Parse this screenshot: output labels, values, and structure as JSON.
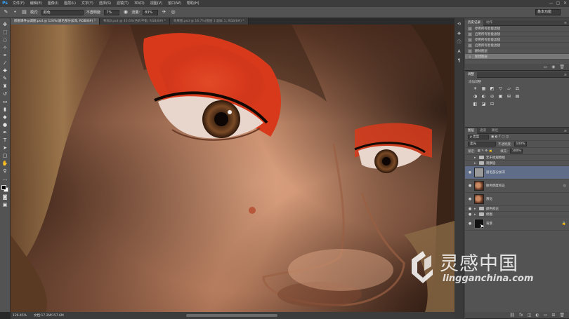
{
  "app": {
    "logo": "Ps",
    "menu": [
      "文件(F)",
      "编辑(E)",
      "图像(I)",
      "图层(L)",
      "文字(Y)",
      "选择(S)",
      "滤镜(T)",
      "3D(D)",
      "视图(V)",
      "窗口(W)",
      "帮助(H)"
    ],
    "window_controls": [
      "—",
      "▢",
      "✕"
    ]
  },
  "options": {
    "mode_label": "模式:",
    "mode_value": "颜色",
    "opacity_label": "不透明度:",
    "opacity_value": "7%",
    "flow_label": "流量:",
    "flow_value": "83%",
    "workspace": "基本功能"
  },
  "doc_tabs": [
    {
      "label": "修图课件@调图.psd @ 126%(眉毛部分加深, RGB/8#) *",
      "active": true
    },
    {
      "label": "布局3.psd @ 43.6%(色彩平衡, RGB/8#) *",
      "active": false
    },
    {
      "label": "效果图.psd @ 16.7%(图层 1 副本 1, RGB/8#) *",
      "active": false
    }
  ],
  "status": {
    "zoom": "126.45%",
    "doc_size": "文档:17.2M/157.6M"
  },
  "history": {
    "tabs": [
      "历史记录",
      "动作"
    ],
    "items": [
      "停用所有智能滤镜",
      "启用所有智能滤镜",
      "停用所有智能滤镜",
      "启用所有智能滤镜",
      "删除图层",
      "新建图层"
    ]
  },
  "adjustments": {
    "tab": "调整",
    "title": "添加调整",
    "icons": [
      "☀",
      "▦",
      "◩",
      "▽",
      "▱",
      "⚖",
      "◑",
      "◐",
      "◎",
      "▣",
      "⊞",
      "▤",
      "◧",
      "◪",
      "⊟"
    ]
  },
  "layers": {
    "tabs": [
      "图层",
      "通道",
      "路径"
    ],
    "filter_label": "ρ 类型",
    "blend_mode": "柔光",
    "opacity_label": "不透明度:",
    "opacity_value": "100%",
    "lock_label": "锁定:",
    "fill_label": "填充:",
    "fill_value": "100%",
    "rows": [
      {
        "name": "无干扰观察组",
        "kind": "folder"
      },
      {
        "name": "观察层",
        "kind": "folder"
      },
      {
        "name": "眉毛部分加深",
        "kind": "layer",
        "thumb": "gray",
        "selected": true
      },
      {
        "name": "肤色明度校正",
        "kind": "layer",
        "thumb": "face"
      },
      {
        "name": "液化",
        "kind": "layer",
        "thumb": "face"
      },
      {
        "name": "颜色校正",
        "kind": "folder"
      },
      {
        "name": "修图",
        "kind": "folder"
      },
      {
        "name": "背景",
        "kind": "layer",
        "thumb": "face",
        "locked": true
      }
    ]
  },
  "watermark": {
    "title": "灵感中国",
    "url": "lingganchina.com"
  }
}
